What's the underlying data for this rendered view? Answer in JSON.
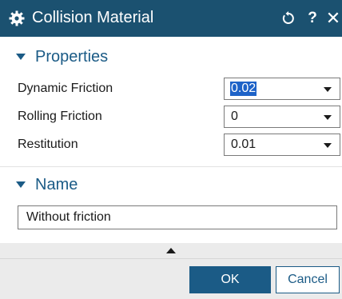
{
  "titlebar": {
    "title": "Collision Material",
    "help_label": "?",
    "close_label": "✕"
  },
  "properties": {
    "header": "Properties",
    "rows": [
      {
        "label": "Dynamic Friction",
        "value": "0.02"
      },
      {
        "label": "Rolling Friction",
        "value": "0"
      },
      {
        "label": "Restitution",
        "value": "0.01"
      }
    ]
  },
  "name_section": {
    "header": "Name",
    "value": "Without friction"
  },
  "footer": {
    "ok_label": "OK",
    "cancel_label": "Cancel"
  },
  "colors": {
    "titlebar_bg": "#1b5170",
    "accent": "#1b5b86",
    "selection": "#1e63c8"
  }
}
